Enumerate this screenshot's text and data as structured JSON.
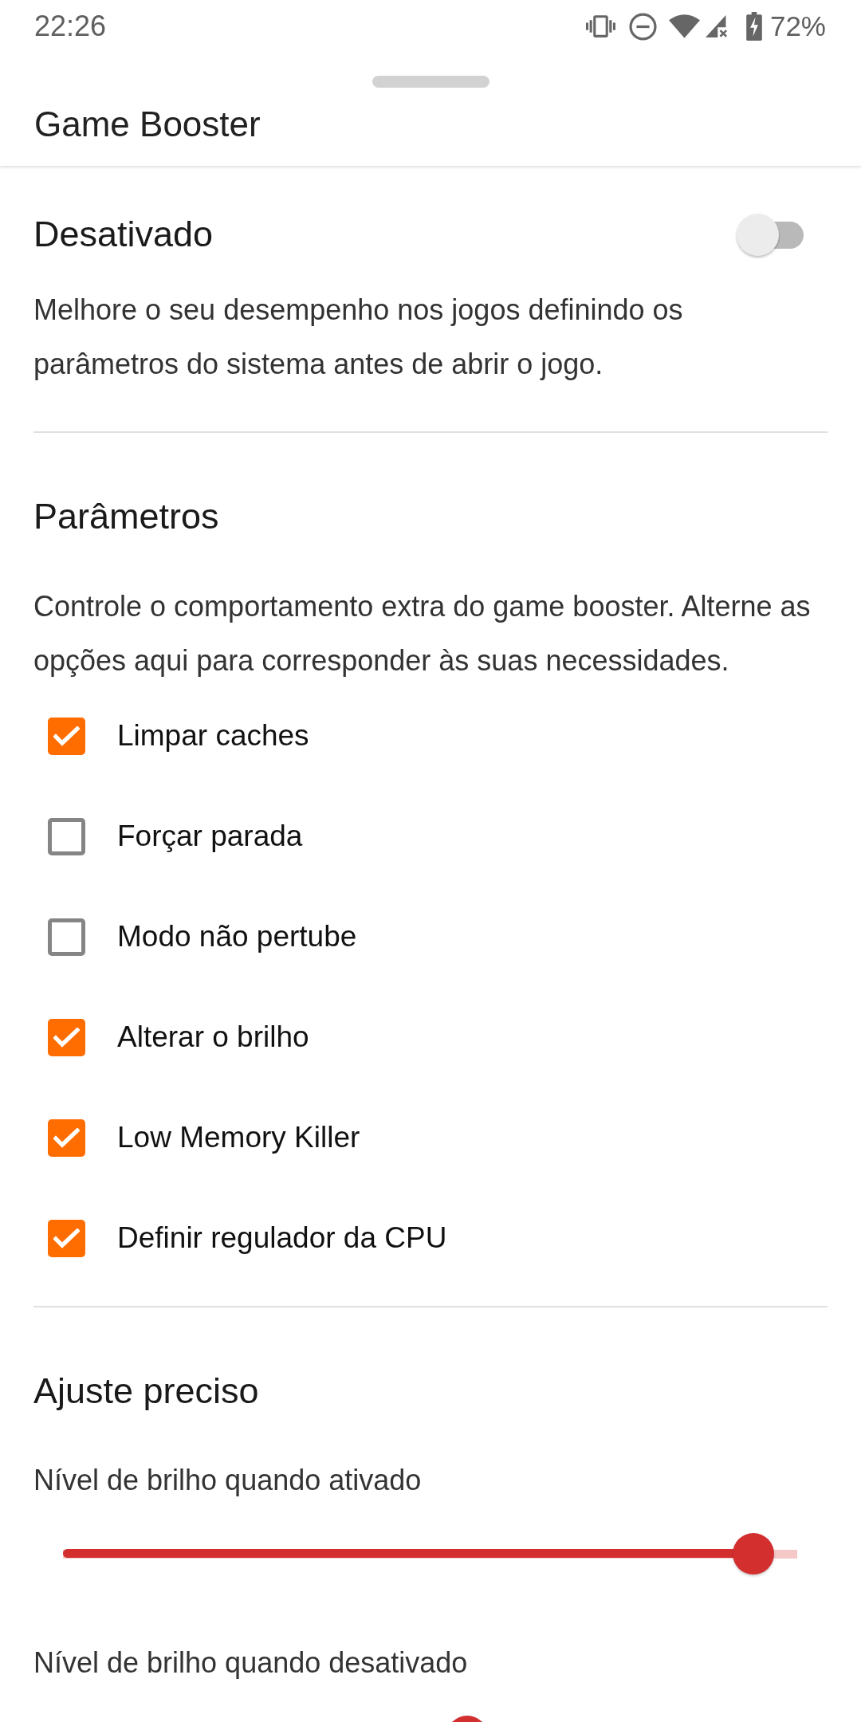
{
  "status_bar": {
    "time": "22:26",
    "battery": "72%"
  },
  "sheet": {
    "title": "Game Booster"
  },
  "master_switch": {
    "label": "Desativado",
    "on": false,
    "description": "Melhore o seu desempenho nos jogos definindo os parâmetros do sistema antes de abrir o jogo."
  },
  "parameters": {
    "title": "Parâmetros",
    "description": "Controle o comportamento extra do game booster. Alterne as opções aqui para corresponder às suas necessidades.",
    "options": [
      {
        "label": "Limpar caches",
        "checked": true
      },
      {
        "label": "Forçar parada",
        "checked": false
      },
      {
        "label": "Modo não pertube",
        "checked": false
      },
      {
        "label": "Alterar o brilho",
        "checked": true
      },
      {
        "label": "Low Memory Killer",
        "checked": true
      },
      {
        "label": "Definir regulador da CPU",
        "checked": true
      }
    ]
  },
  "fine_tuning": {
    "title": "Ajuste preciso",
    "sliders": [
      {
        "label": "Nível de brilho quando ativado",
        "level": 0.94
      },
      {
        "label": "Nível de brilho quando desativado",
        "level": 0.55
      }
    ]
  }
}
